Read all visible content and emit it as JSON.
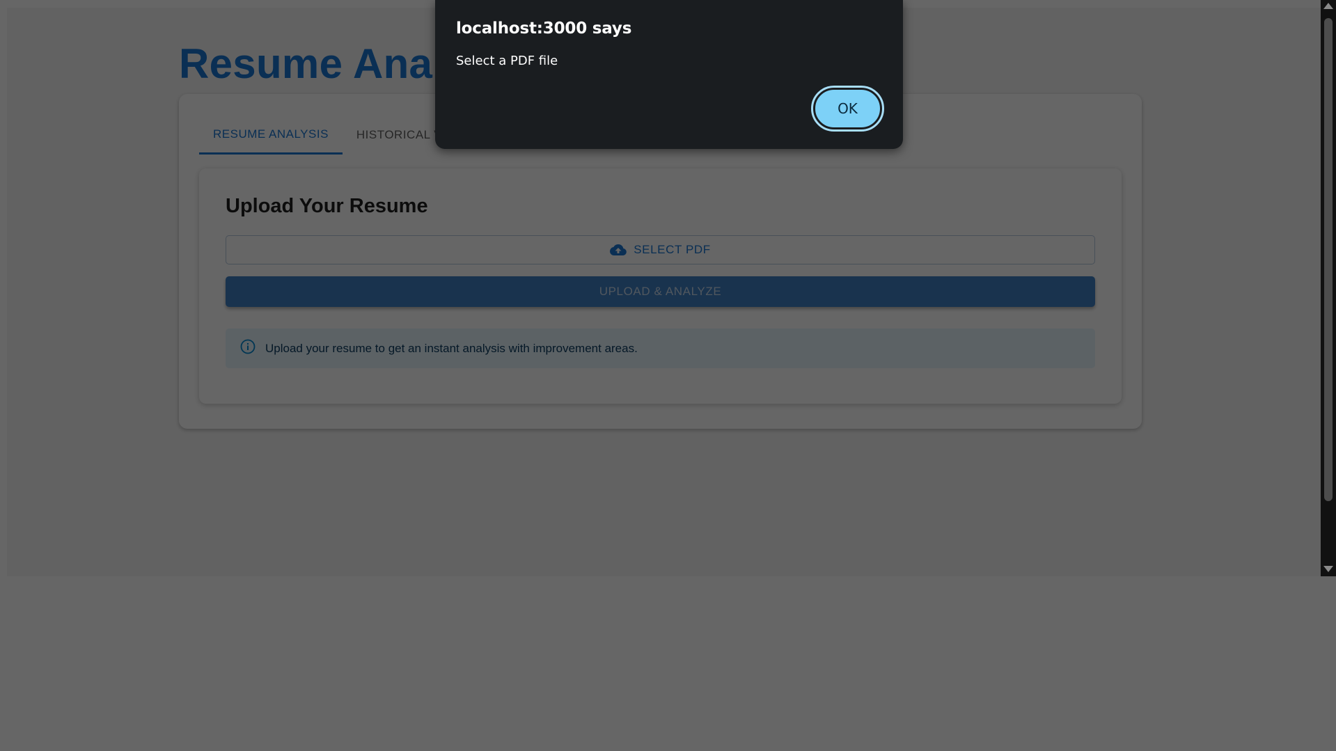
{
  "page": {
    "title": "Resume Analysis",
    "tabs": [
      {
        "label": "RESUME ANALYSIS",
        "active": true
      },
      {
        "label": "HISTORICAL VIEW",
        "active": false
      }
    ],
    "upload_card": {
      "heading": "Upload Your Resume",
      "select_pdf_label": "SELECT PDF",
      "upload_analyze_label": "UPLOAD & ANALYZE",
      "info_text": "Upload your resume to get an instant analysis with improvement areas."
    }
  },
  "alert": {
    "origin": "localhost:3000 says",
    "message": "Select a PDF file",
    "ok_label": "OK"
  },
  "icons": {
    "select_pdf": "cloud-upload-icon",
    "info": "info-icon"
  },
  "colors": {
    "primary": "#1976d2",
    "alert_background": "#1a1d20",
    "ok_button": "#7dd1f7",
    "info_background": "#e5f4fc"
  }
}
